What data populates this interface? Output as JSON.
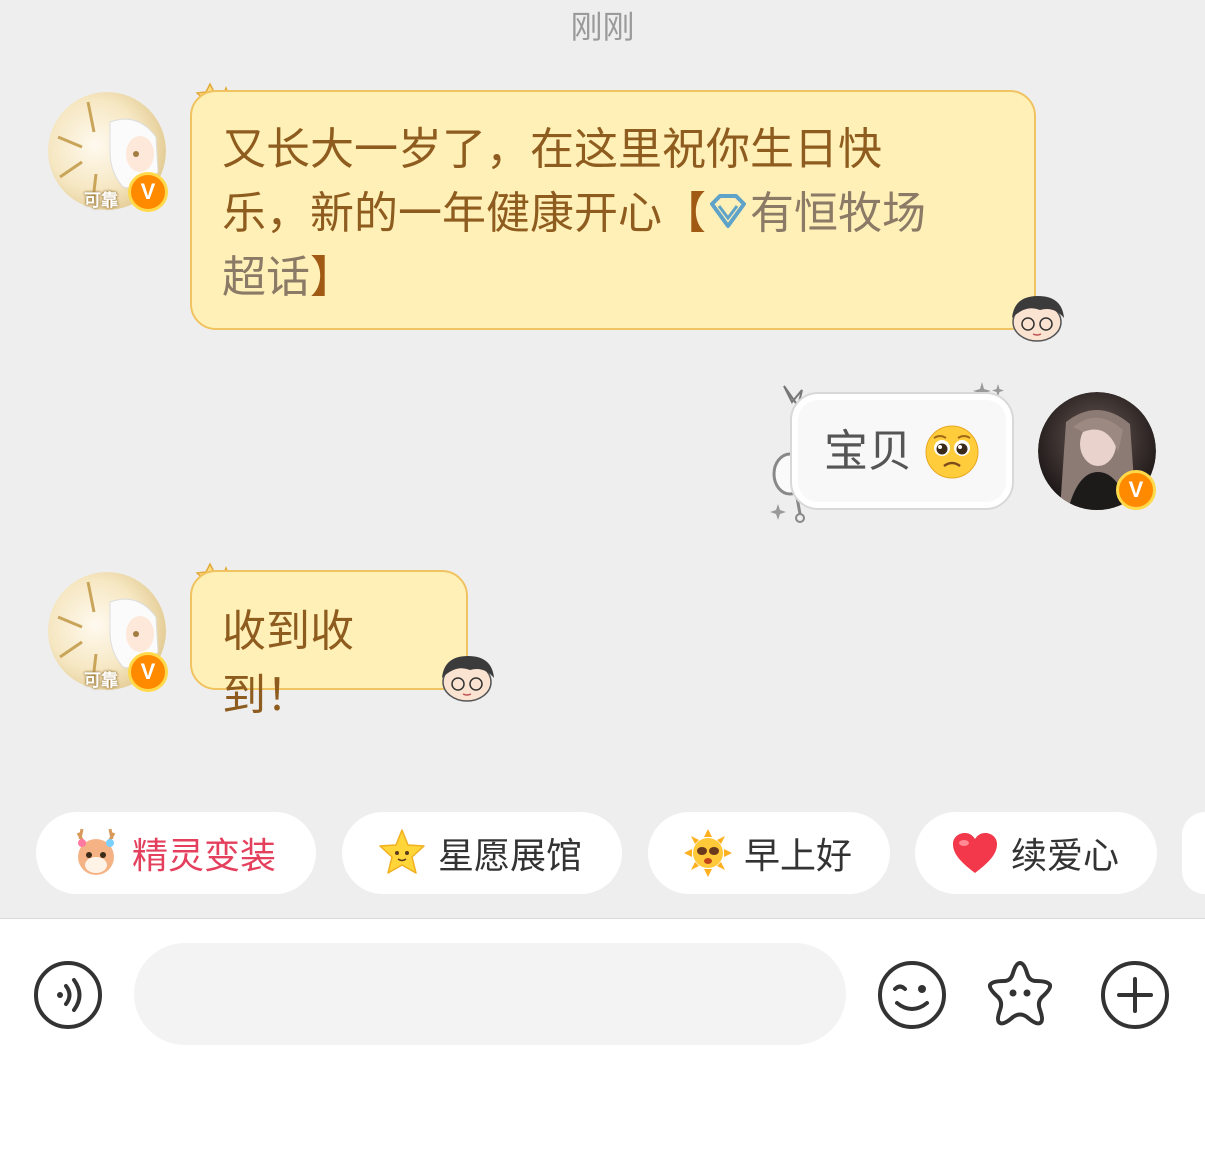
{
  "timestamp": "刚刚",
  "messages": [
    {
      "id": "msg1",
      "sender_side": "left",
      "avatar_label": "可靠",
      "verified_badge": "V",
      "lines": [
        "又长大一岁了，在这里祝你生日快",
        "乐，新的一年健康开心"
      ],
      "topic_open": "【",
      "topic_text": "有恒牧场",
      "topic_line2": "超话",
      "topic_close": "】"
    },
    {
      "id": "msg2",
      "sender_side": "right",
      "verified_badge": "V",
      "text": "宝贝",
      "emoji": "pleading-face"
    },
    {
      "id": "msg3",
      "sender_side": "left",
      "avatar_label": "可靠",
      "verified_badge": "V",
      "text": "收到收到！"
    }
  ],
  "quick_replies": [
    {
      "label": "精灵变装",
      "icon": "fawn-icon",
      "color": "#e4405e"
    },
    {
      "label": "星愿展馆",
      "icon": "star-face-icon",
      "color": "#333333"
    },
    {
      "label": "早上好",
      "icon": "sun-face-icon",
      "color": "#333333"
    },
    {
      "label": "续爱心",
      "icon": "heart-icon",
      "color": "#333333"
    }
  ],
  "input": {
    "placeholder": "",
    "value": ""
  },
  "toolbar": {
    "voice_icon": "voice-icon",
    "emoji_icon": "smiley-icon",
    "sticker_icon": "star-sticker-icon",
    "more_icon": "plus-icon"
  },
  "colors": {
    "bubble_bg": "#fff0b8",
    "bubble_border": "#f1c360",
    "bubble_text": "#8e5c1e",
    "badge": "#ff8a00",
    "chip_red": "#e4405e"
  }
}
